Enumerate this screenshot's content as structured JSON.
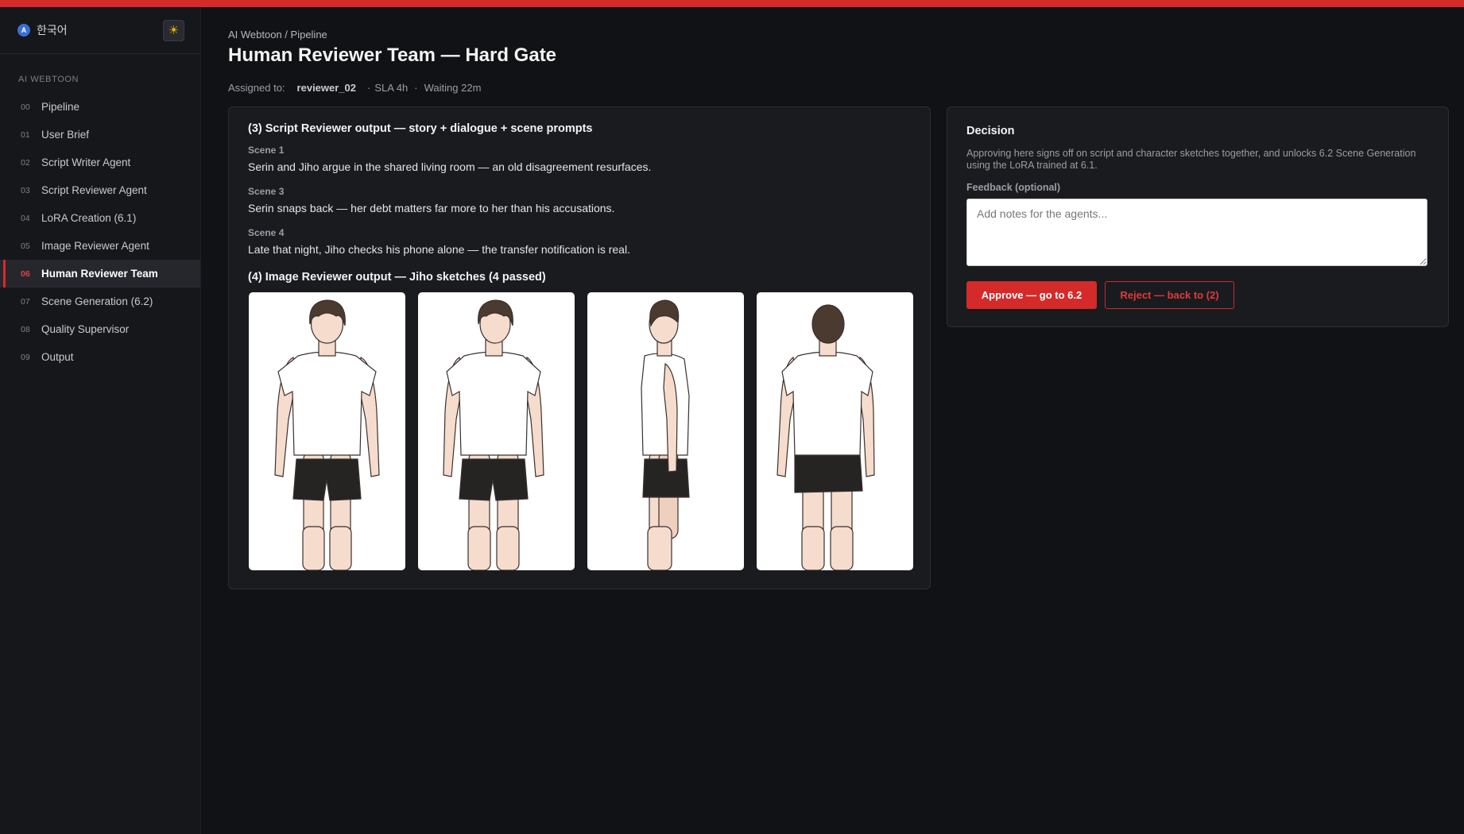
{
  "sidebar": {
    "lang_badge": "A",
    "language": "한국어",
    "theme_icon": "☀",
    "section_label": "AI WEBTOON",
    "items": [
      {
        "num": "00",
        "label": "Pipeline"
      },
      {
        "num": "01",
        "label": "User Brief"
      },
      {
        "num": "02",
        "label": "Script Writer Agent"
      },
      {
        "num": "03",
        "label": "Script Reviewer Agent"
      },
      {
        "num": "04",
        "label": "LoRA Creation (6.1)"
      },
      {
        "num": "05",
        "label": "Image Reviewer Agent"
      },
      {
        "num": "06",
        "label": "Human Reviewer Team",
        "active": true
      },
      {
        "num": "07",
        "label": "Scene Generation (6.2)"
      },
      {
        "num": "08",
        "label": "Quality Supervisor"
      },
      {
        "num": "09",
        "label": "Output"
      }
    ]
  },
  "header": {
    "breadcrumb": "AI Webtoon / Pipeline",
    "title": "Human Reviewer Team — Hard Gate",
    "assigned_label": "Assigned to:",
    "assignee": "reviewer_02",
    "sla": "SLA 4h",
    "waiting": "Waiting 22m",
    "separator": "·"
  },
  "script_review": {
    "title": "(3) Script Reviewer output — story + dialogue + scene prompts",
    "scenes": [
      {
        "label": "Scene 1",
        "text": "Serin and Jiho argue in the shared living room — an old disagreement resurfaces."
      },
      {
        "label": "Scene 3",
        "text": "Serin snaps back — her debt matters far more to her than his accusations."
      },
      {
        "label": "Scene 4",
        "text": "Late that night, Jiho checks his phone alone — the transfer notification is real."
      }
    ]
  },
  "image_review": {
    "title": "(4) Image Reviewer output — Jiho sketches (4 passed)",
    "sketches": [
      "front",
      "three-quarter",
      "side",
      "back"
    ]
  },
  "decision": {
    "title": "Decision",
    "description": "Approving here signs off on script and character sketches together, and unlocks 6.2 Scene Generation using the LoRA trained at 6.1.",
    "feedback_label": "Feedback (optional)",
    "feedback_placeholder": "Add notes for the agents...",
    "feedback_value": "",
    "approve_label": "Approve — go to 6.2",
    "reject_label": "Reject — back to (2)"
  },
  "colors": {
    "accent": "#d42a2a",
    "background": "#111216",
    "panel": "#1a1b1f"
  }
}
